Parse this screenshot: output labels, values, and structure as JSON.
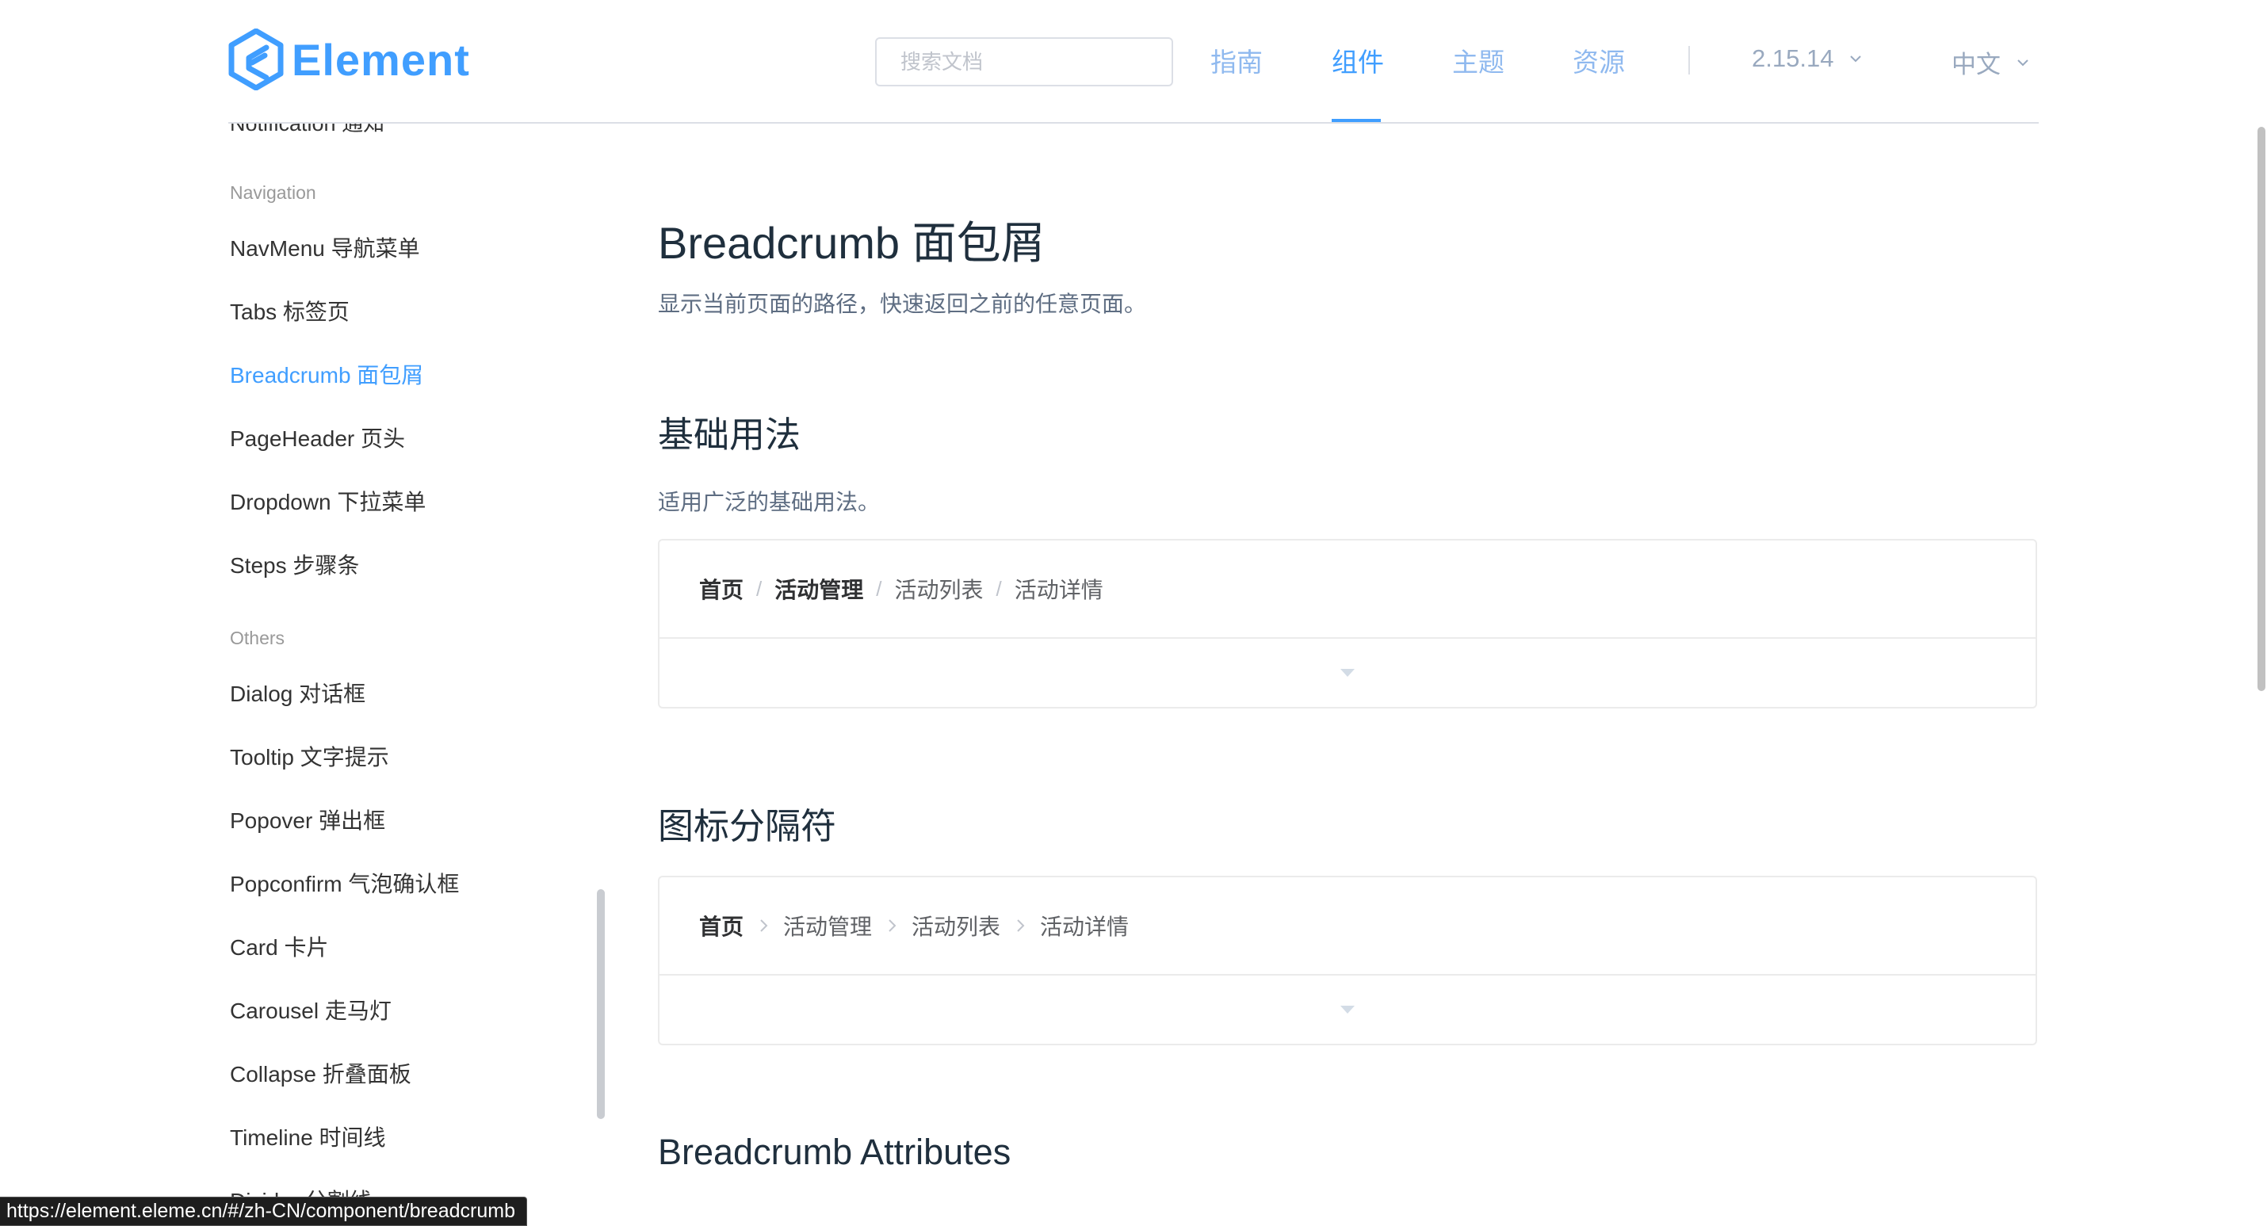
{
  "header": {
    "logo_text": "Element",
    "search_placeholder": "搜索文档",
    "nav": [
      "指南",
      "组件",
      "主题",
      "资源"
    ],
    "active_nav": "组件",
    "version": "2.15.14",
    "language": "中文"
  },
  "sidebar": {
    "clipped_item": "Notification 通知",
    "groups": [
      {
        "title": "Navigation",
        "items": [
          "NavMenu 导航菜单",
          "Tabs 标签页",
          "Breadcrumb 面包屑",
          "PageHeader 页头",
          "Dropdown 下拉菜单",
          "Steps 步骤条"
        ]
      },
      {
        "title": "Others",
        "items": [
          "Dialog 对话框",
          "Tooltip 文字提示",
          "Popover 弹出框",
          "Popconfirm 气泡确认框",
          "Card 卡片",
          "Carousel 走马灯",
          "Collapse 折叠面板",
          "Timeline 时间线",
          "Divider 分割线"
        ]
      }
    ],
    "active_item": "Breadcrumb 面包屑"
  },
  "main": {
    "title": "Breadcrumb 面包屑",
    "lead": "显示当前页面的路径，快速返回之前的任意页面。",
    "sections": [
      {
        "heading": "基础用法",
        "description": "适用广泛的基础用法。",
        "separator": "/",
        "crumbs": [
          "首页",
          "活动管理",
          "活动列表",
          "活动详情"
        ]
      },
      {
        "heading": "图标分隔符",
        "separator_icon": "chevron-right-icon",
        "crumbs": [
          "首页",
          "活动管理",
          "活动列表",
          "活动详情"
        ]
      }
    ],
    "attributes_heading": "Breadcrumb Attributes"
  },
  "status_bar": {
    "url": "https://element.eleme.cn/#/zh-CN/component/breadcrumb"
  },
  "colors": {
    "brand": "#409eff",
    "text_primary": "#1f2f3d",
    "text_secondary": "#5e6d82",
    "nav_inactive": "#8fb9ef",
    "border": "#ebebeb"
  }
}
